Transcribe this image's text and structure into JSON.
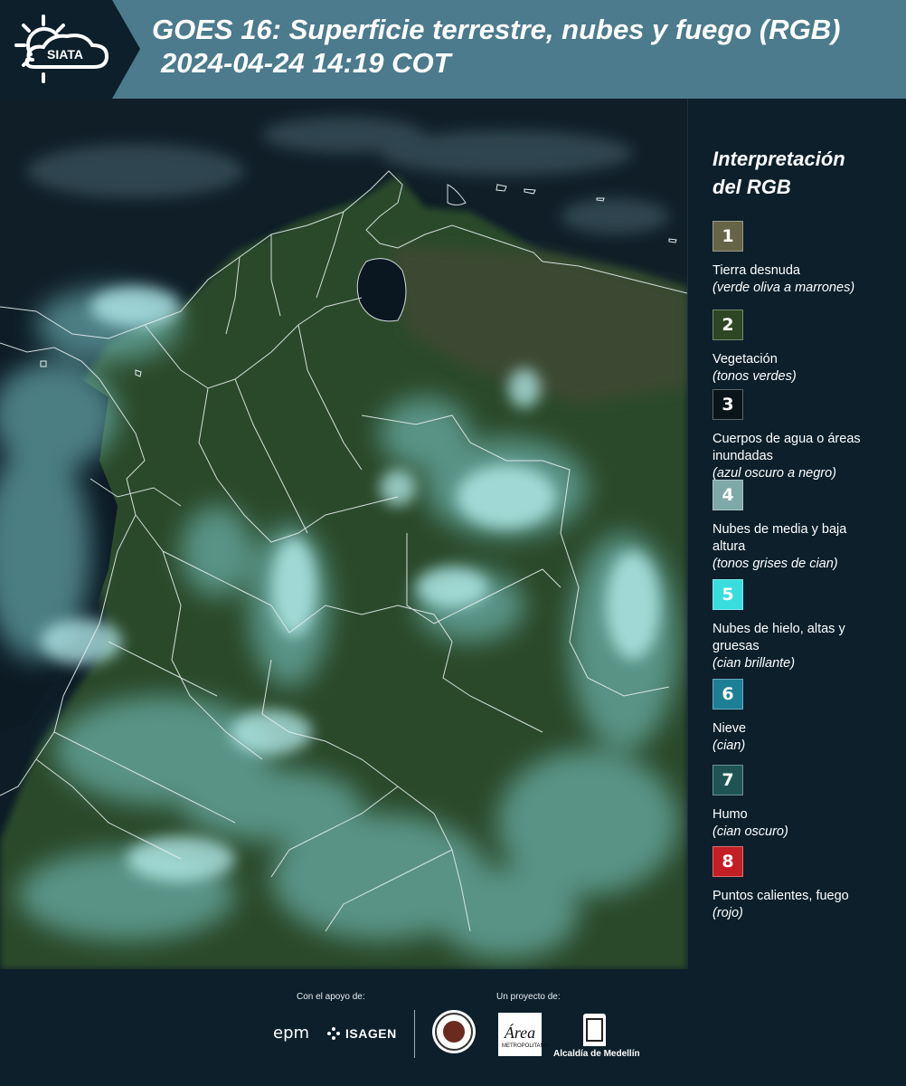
{
  "header": {
    "logo_text": "SIATA",
    "title_line1": "GOES 16: Superficie terrestre, nubes y fuego (RGB)",
    "title_line2": "2024-04-24 14:19 COT"
  },
  "legend": {
    "title_line1": "Interpretación",
    "title_line2": "del RGB",
    "items": [
      {
        "number": "1",
        "color": "#666447",
        "label": "Tierra desnuda",
        "note": "(verde oliva a marrones)"
      },
      {
        "number": "2",
        "color": "#2e4623",
        "label": "Vegetación",
        "note": "(tonos verdes)"
      },
      {
        "number": "3",
        "color": "#0a141b",
        "label": "Cuerpos de agua o áreas inundadas",
        "note": "(azul oscuro a negro)"
      },
      {
        "number": "4",
        "color": "#7fa8a8",
        "label": "Nubes de media y baja altura",
        "note": "(tonos grises de cian)"
      },
      {
        "number": "5",
        "color": "#38dede",
        "label": "Nubes de hielo, altas y gruesas",
        "note": "(cian brillante)"
      },
      {
        "number": "6",
        "color": "#1c7f96",
        "label": "Nieve",
        "note": "(cian)"
      },
      {
        "number": "7",
        "color": "#1f5454",
        "label": "Humo",
        "note": "(cian oscuro)"
      },
      {
        "number": "8",
        "color": "#c41f24",
        "label": "Puntos calientes, fuego",
        "note": "(rojo)"
      }
    ]
  },
  "footer": {
    "support_label": "Con el apoyo de:",
    "project_label": "Un proyecto de:",
    "epm": "epm",
    "isagen": "ISAGEN",
    "area_text": "METROPOLITANA",
    "alcaldia": "Alcaldía de Medellín"
  }
}
